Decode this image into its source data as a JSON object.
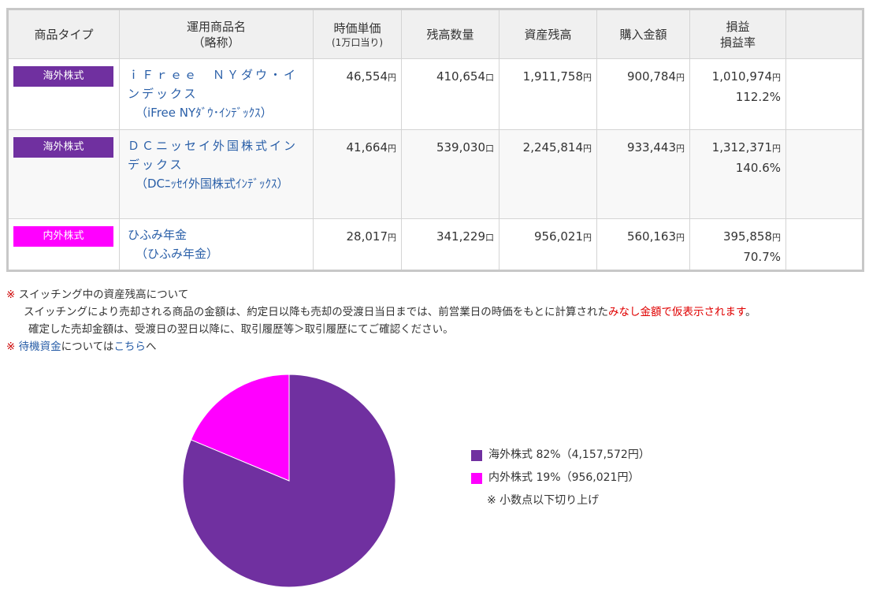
{
  "table": {
    "headers": {
      "type": "商品タイプ",
      "name": "運用商品名",
      "name_sub": "（略称）",
      "price": "時価単価",
      "price_sub": "(1万口当り)",
      "units": "残高数量",
      "assets": "資産残高",
      "purchase": "購入金額",
      "pl": "損益",
      "pl_rate": "損益率"
    },
    "rows": [
      {
        "type": "海外株式",
        "type_color": "#7030a0",
        "name": "ｉＦｒｅｅ　ＮＹダウ・インデックス",
        "short_name": "（iFree NYﾀﾞｳ･ｲﾝﾃﾞｯｸｽ）",
        "price": "46,554",
        "price_unit": "円",
        "units": "410,654",
        "units_unit": "口",
        "assets": "1,911,758",
        "assets_unit": "円",
        "purchase": "900,784",
        "purchase_unit": "円",
        "pl": "1,010,974",
        "pl_unit": "円",
        "pl_rate": "112.2%"
      },
      {
        "type": "海外株式",
        "type_color": "#7030a0",
        "name": "ＤＣニッセイ外国株式インデックス",
        "short_name": "（DCﾆｯｾｲ外国株式ｲﾝﾃﾞｯｸｽ）",
        "price": "41,664",
        "price_unit": "円",
        "units": "539,030",
        "units_unit": "口",
        "assets": "2,245,814",
        "assets_unit": "円",
        "purchase": "933,443",
        "purchase_unit": "円",
        "pl": "1,312,371",
        "pl_unit": "円",
        "pl_rate": "140.6%"
      },
      {
        "type": "内外株式",
        "type_color": "#ff00ff",
        "name": "ひふみ年金",
        "short_name": "（ひふみ年金）",
        "price": "28,017",
        "price_unit": "円",
        "units": "341,229",
        "units_unit": "口",
        "assets": "956,021",
        "assets_unit": "円",
        "purchase": "560,163",
        "purchase_unit": "円",
        "pl": "395,858",
        "pl_unit": "円",
        "pl_rate": "70.7%"
      }
    ]
  },
  "notes": {
    "mark": "※",
    "switching_title": "スイッチング中の資産残高について",
    "switching_line1_a": "スイッチングにより売却される商品の金額は、約定日以降も売却の受渡日当日までは、前営業日の時価をもとに計算された",
    "switching_line1_red": "みなし金額で仮表示されます",
    "switching_line1_end": "。",
    "switching_line2": "確定した売却金額は、受渡日の翌日以降に、取引履歴等＞取引履歴にてご確認ください。",
    "standby_link": "待機資金",
    "standby_text": "については",
    "here_link": "こちら",
    "here_suffix": "へ"
  },
  "chart_data": {
    "type": "pie",
    "title": "",
    "series": [
      {
        "name": "海外株式",
        "percent": 82,
        "amount": "4,157,572円",
        "value": 4157572,
        "color": "#7030a0"
      },
      {
        "name": "内外株式",
        "percent": 19,
        "amount": "956,021円",
        "value": 956021,
        "color": "#ff00ff"
      }
    ],
    "legend": [
      "海外株式  82%（4,157,572円）",
      "内外株式  19%（956,021円）"
    ],
    "legend_position": "right",
    "footnote": "※ 小数点以下切り上げ"
  }
}
